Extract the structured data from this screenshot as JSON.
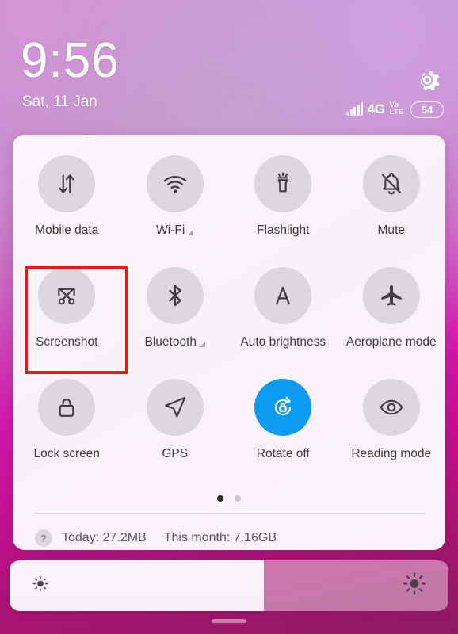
{
  "statusbar": {
    "time": "9:56",
    "date": "Sat, 11 Jan",
    "network_type": "4G",
    "volte_line1": "Vo",
    "volte_line2": "LTE",
    "battery_level": "54",
    "settings_icon": "gear-icon",
    "signal_icon": "signal-bars-icon"
  },
  "panel": {
    "tiles": [
      {
        "label": "Mobile data",
        "icon": "mobile-data-icon",
        "active": false,
        "expandable": false
      },
      {
        "label": "Wi-Fi",
        "icon": "wifi-icon",
        "active": false,
        "expandable": true
      },
      {
        "label": "Flashlight",
        "icon": "flashlight-icon",
        "active": false,
        "expandable": false
      },
      {
        "label": "Mute",
        "icon": "bell-muted-icon",
        "active": false,
        "expandable": false
      },
      {
        "label": "Screenshot",
        "icon": "screenshot-icon",
        "active": false,
        "expandable": false
      },
      {
        "label": "Bluetooth",
        "icon": "bluetooth-icon",
        "active": false,
        "expandable": true
      },
      {
        "label": "Auto brightness",
        "icon": "auto-brightness-icon",
        "active": false,
        "expandable": false
      },
      {
        "label": "Aeroplane mode",
        "icon": "aeroplane-icon",
        "active": false,
        "expandable": false
      },
      {
        "label": "Lock screen",
        "icon": "padlock-icon",
        "active": false,
        "expandable": false
      },
      {
        "label": "GPS",
        "icon": "location-arrow-icon",
        "active": false,
        "expandable": false
      },
      {
        "label": "Rotate off",
        "icon": "rotate-lock-icon",
        "active": true,
        "expandable": false
      },
      {
        "label": "Reading mode",
        "icon": "eye-icon",
        "active": false,
        "expandable": false
      }
    ],
    "highlighted_tile": "Screenshot",
    "pagination": {
      "total": 2,
      "current": 1
    },
    "usage": {
      "help_icon_label": "?",
      "today": "Today: 27.2MB",
      "this_month": "This month: 7.16GB"
    }
  },
  "brightness": {
    "value_percent": 58,
    "low_icon": "brightness-low-icon",
    "high_icon": "brightness-high-icon"
  },
  "colors": {
    "accent_active": "#0d9bf2",
    "highlight_box": "#e8151b",
    "tile_circle": "#dcd6dd",
    "panel_bg": "#fbf4fa"
  }
}
